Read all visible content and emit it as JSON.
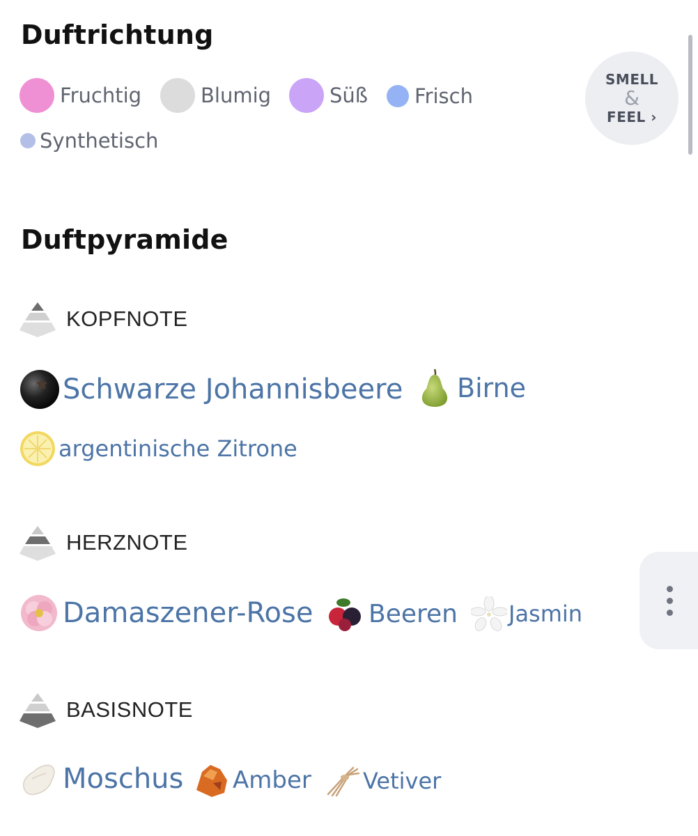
{
  "direction": {
    "title": "Duftrichtung",
    "accords": [
      {
        "label": "Fruchtig",
        "color": "#f090d4"
      },
      {
        "label": "Blumig",
        "color": "#dcdcdc"
      },
      {
        "label": "Süß",
        "color": "#caa4f6"
      },
      {
        "label": "Frisch",
        "color": "#94b2f4"
      },
      {
        "label": "Synthetisch",
        "color": "#b4bfe8"
      }
    ],
    "smell_feel": {
      "line1": "SMELL",
      "amp": "&",
      "line2": "FEEL ›"
    }
  },
  "pyramid": {
    "title": "Duftpyramide",
    "tiers": [
      {
        "label": "KOPFNOTE",
        "notes": [
          {
            "name": "Schwarze Johannisbeere",
            "icon": "blackcurrant-icon"
          },
          {
            "name": "Birne",
            "icon": "pear-icon"
          },
          {
            "name": "argentinische Zitrone",
            "icon": "lemon-icon"
          }
        ]
      },
      {
        "label": "HERZNOTE",
        "notes": [
          {
            "name": "Damaszener-Rose",
            "icon": "rose-icon"
          },
          {
            "name": "Beeren",
            "icon": "berries-icon"
          },
          {
            "name": "Jasmin",
            "icon": "jasmine-icon"
          }
        ]
      },
      {
        "label": "BASISNOTE",
        "notes": [
          {
            "name": "Moschus",
            "icon": "musk-icon"
          },
          {
            "name": "Amber",
            "icon": "amber-icon"
          },
          {
            "name": "Vetiver",
            "icon": "vetiver-icon"
          }
        ]
      }
    ]
  },
  "side_menu": {
    "icon": "more-vertical-icon"
  }
}
